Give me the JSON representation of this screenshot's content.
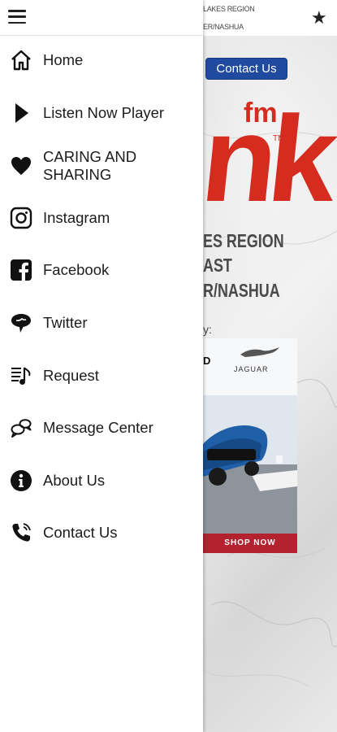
{
  "background": {
    "header_line1": "LAKES REGION",
    "header_line2": "ER/NASHUA",
    "star_icon": "star-icon",
    "contact_button": "Contact Us",
    "logo": {
      "fm": "fm",
      "tm": "TM",
      "letters": "nk"
    },
    "region_text": [
      "ES REGION",
      "AST",
      "R/NASHUA"
    ],
    "sponsored_by": "y:",
    "ad": {
      "brand_fragment": "D",
      "brand": "JAGUAR",
      "cta": "SHOP NOW"
    }
  },
  "drawer": {
    "menu_icon": "hamburger-icon",
    "items": [
      {
        "label": "Home",
        "icon": "home-icon"
      },
      {
        "label": "Listen Now Player",
        "icon": "play-icon"
      },
      {
        "label": "CARING AND SHARING",
        "icon": "heart-icon"
      },
      {
        "label": "Instagram",
        "icon": "instagram-icon"
      },
      {
        "label": "Facebook",
        "icon": "facebook-icon"
      },
      {
        "label": "Twitter",
        "icon": "twitter-icon"
      },
      {
        "label": "Request",
        "icon": "music-request-icon"
      },
      {
        "label": "Message Center",
        "icon": "message-center-icon"
      },
      {
        "label": "About Us",
        "icon": "info-icon"
      },
      {
        "label": "Contact Us",
        "icon": "phone-icon"
      }
    ]
  },
  "colors": {
    "contact_button": "#1f4aa0",
    "logo_red": "#d62b1f",
    "ad_cta": "#b3222e",
    "menu_text": "#1c1c1c"
  }
}
